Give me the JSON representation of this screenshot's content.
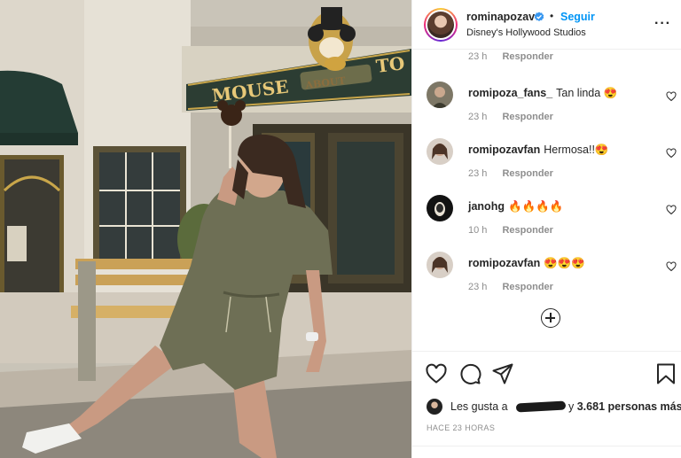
{
  "post": {
    "username": "rominapozav",
    "follow_label": "Seguir",
    "location": "Disney's Hollywood Studios",
    "separator": "•"
  },
  "photo": {
    "shop_sign": "MOUSE ABOUT TOWN",
    "sign_parts": [
      "MOUSE",
      "ABOUT",
      "TO"
    ]
  },
  "comments": {
    "top_meta": {
      "time": "23 h",
      "reply_label": "Responder"
    },
    "items": [
      {
        "user": "romipoza_fans_",
        "text": "Tan linda 😍",
        "time": "23 h",
        "reply_label": "Responder"
      },
      {
        "user": "romipozavfan",
        "text": "Hermosa!!😍",
        "time": "23 h",
        "reply_label": "Responder"
      },
      {
        "user": "janohg",
        "text": "🔥🔥🔥🔥",
        "time": "10 h",
        "reply_label": "Responder"
      },
      {
        "user": "romipozavfan",
        "text": "😍😍😍",
        "time": "23 h",
        "reply_label": "Responder"
      }
    ]
  },
  "likes": {
    "prefix": "Les gusta a",
    "suffix_and": "y",
    "count": "3.681",
    "suffix_more": "personas más"
  },
  "timestamp": "HACE 23 HORAS",
  "colors": {
    "link_blue": "#0095f6",
    "text": "#262626",
    "muted": "#8e8e8e",
    "divider": "#efefef"
  },
  "icons": [
    "verified-badge-icon",
    "more-options-icon",
    "heart-icon",
    "comment-icon",
    "share-icon",
    "bookmark-icon",
    "plus-circle-icon"
  ]
}
